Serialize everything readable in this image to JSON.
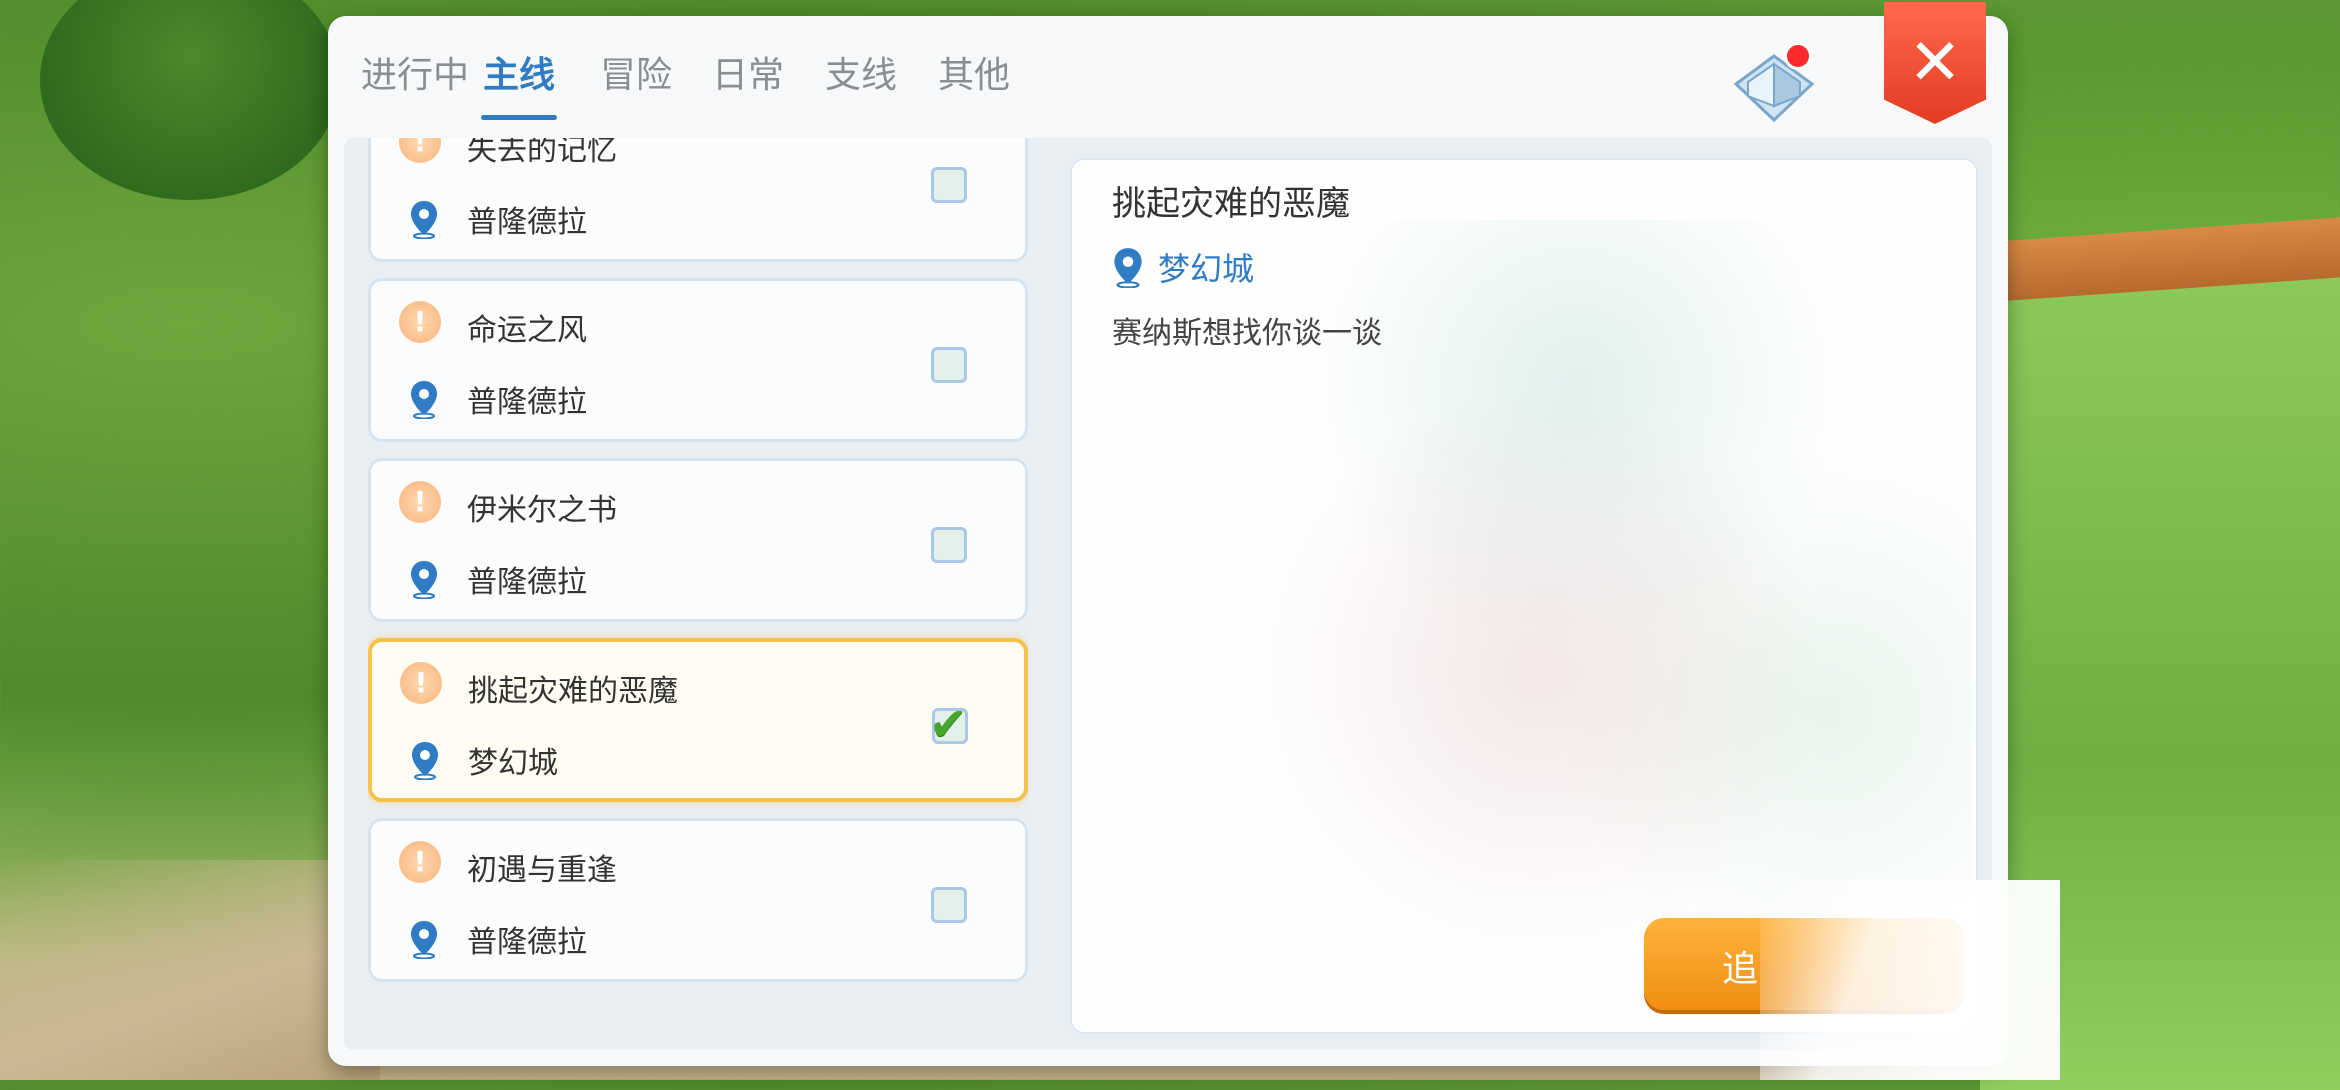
{
  "tabs": [
    {
      "label": "进行中"
    },
    {
      "label": "主线",
      "active": true
    },
    {
      "label": "冒险"
    },
    {
      "label": "日常"
    },
    {
      "label": "支线"
    },
    {
      "label": "其他"
    }
  ],
  "quests": [
    {
      "title": "失去的记忆",
      "location": "普隆德拉",
      "checked": false
    },
    {
      "title": "命运之风",
      "location": "普隆德拉",
      "checked": false
    },
    {
      "title": "伊米尔之书",
      "location": "普隆德拉",
      "checked": false
    },
    {
      "title": "挑起灾难的恶魔",
      "location": "梦幻城",
      "checked": true,
      "selected": true
    },
    {
      "title": "初遇与重逢",
      "location": "普隆德拉",
      "checked": false
    }
  ],
  "detail": {
    "title": "挑起灾难的恶魔",
    "location": "梦幻城",
    "description": "赛纳斯想找你谈一谈"
  },
  "track_button": {
    "label": "追"
  },
  "icons": {
    "alert": "exclamation-icon",
    "location": "location-pin-icon",
    "close": "close-icon",
    "book": "quest-book-icon",
    "check": "check-icon"
  },
  "colors": {
    "accent_blue": "#2f7cc4",
    "close_red": "#e23b22",
    "selected_border": "#f6c24c",
    "track_orange": "#f08e12",
    "notification_dot": "#ff2a2a"
  }
}
